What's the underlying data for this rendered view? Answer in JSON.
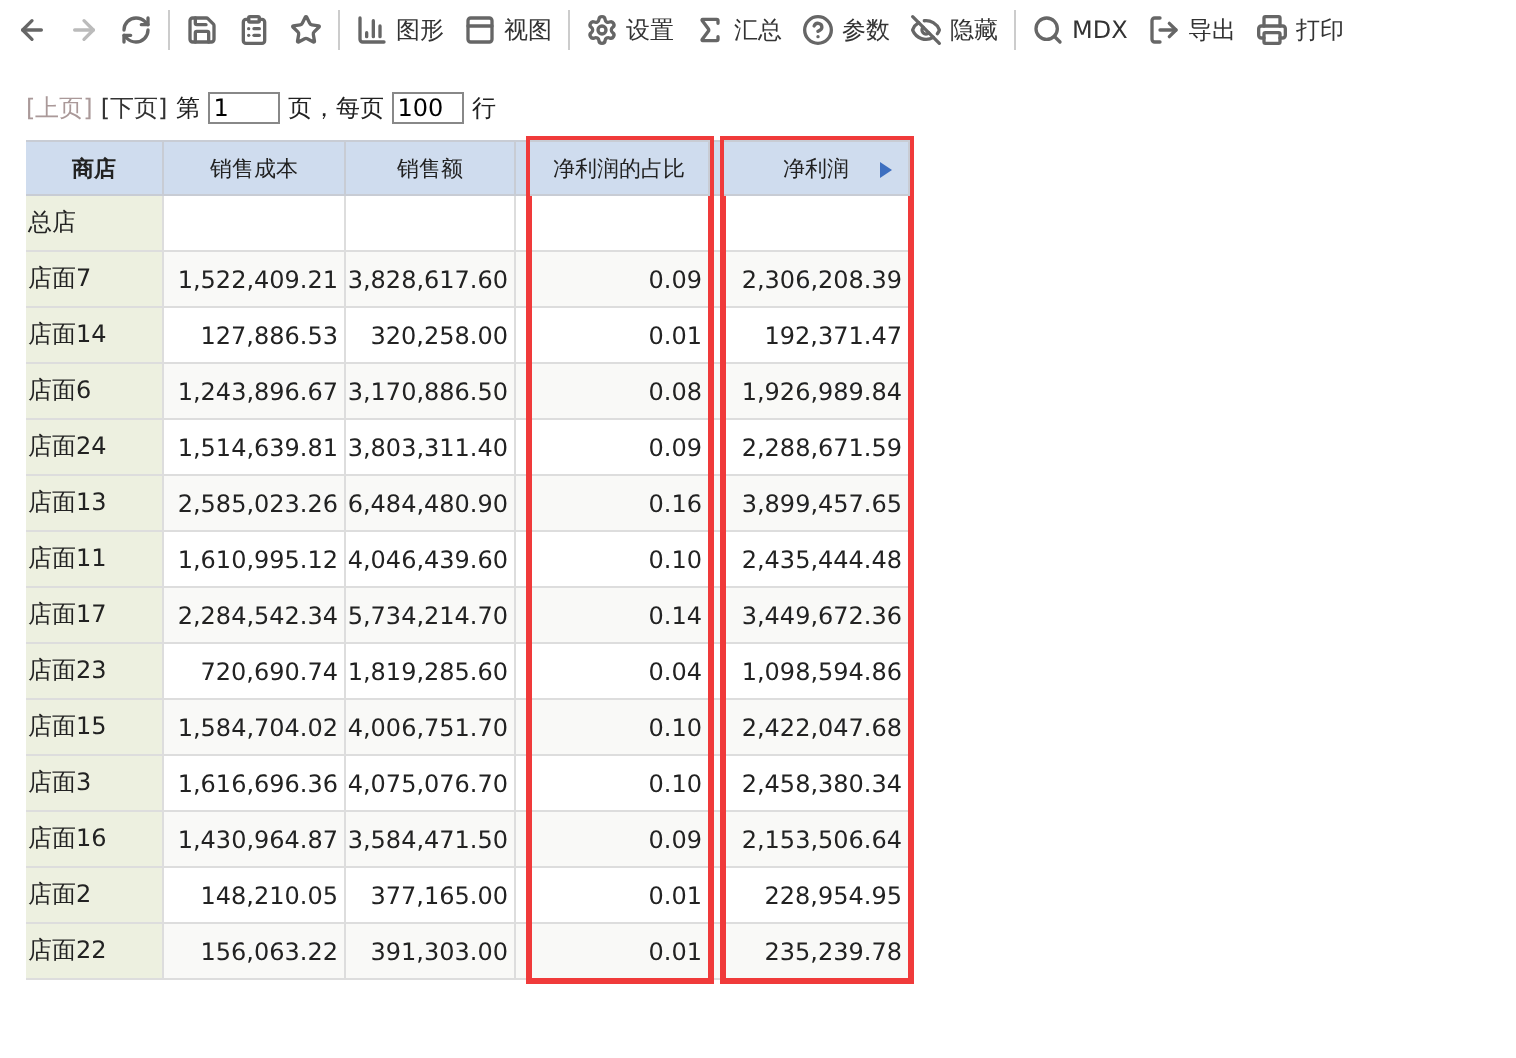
{
  "toolbar": [
    [
      {
        "disabled": false
      },
      {
        "disabled": true
      },
      {
        "disabled": false
      }
    ],
    [
      {
        "disabled": false
      },
      {
        "disabled": false
      },
      {
        "disabled": false
      }
    ],
    [
      {
        "label": "图形",
        "disabled": false
      },
      {
        "label": "视图",
        "disabled": false
      }
    ],
    [
      {
        "label": "设置",
        "disabled": false
      },
      {
        "label": "汇总",
        "disabled": false
      },
      {
        "label": "参数",
        "disabled": false
      },
      {
        "label": "隐藏",
        "disabled": false
      }
    ],
    [
      {
        "label": "MDX",
        "disabled": false
      },
      {
        "label": "导出",
        "disabled": false
      },
      {
        "label": "打印",
        "disabled": false
      }
    ]
  ],
  "pager": {
    "prev": {
      "label": "[上页]",
      "disabled": true
    },
    "next": {
      "label": "[下页]",
      "disabled": false
    },
    "page_prefix": "第",
    "page": "1",
    "per_page_prefix": "页，每页",
    "per_page": "100",
    "per_page_suffix": "行"
  },
  "table": {
    "columns": [
      {
        "label": "商店",
        "highlighted": false,
        "kind": "row_header"
      },
      {
        "label": "销售成本",
        "highlighted": false,
        "kind": "measure"
      },
      {
        "label": "销售额",
        "highlighted": false,
        "kind": "measure"
      },
      {
        "kind": "blank",
        "highlighted": false
      },
      {
        "label": "净利润的占比",
        "highlighted": true,
        "kind": "measure"
      },
      {
        "kind": "blank",
        "highlighted": false
      },
      {
        "label": "净利润",
        "highlighted": true,
        "kind": "measure",
        "expand_arrow": true
      }
    ],
    "rows": [
      {
        "store": "总店"
      },
      {
        "store": "店面7",
        "values": [
          "1,522,409.21",
          "3,828,617.60",
          "0.09",
          "2,306,208.39"
        ]
      },
      {
        "store": "店面14",
        "values": [
          "127,886.53",
          "320,258.00",
          "0.01",
          "192,371.47"
        ]
      },
      {
        "store": "店面6",
        "values": [
          "1,243,896.67",
          "3,170,886.50",
          "0.08",
          "1,926,989.84"
        ]
      },
      {
        "store": "店面24",
        "values": [
          "1,514,639.81",
          "3,803,311.40",
          "0.09",
          "2,288,671.59"
        ]
      },
      {
        "store": "店面13",
        "values": [
          "2,585,023.26",
          "6,484,480.90",
          "0.16",
          "3,899,457.65"
        ]
      },
      {
        "store": "店面11",
        "values": [
          "1,610,995.12",
          "4,046,439.60",
          "0.10",
          "2,435,444.48"
        ]
      },
      {
        "store": "店面17",
        "values": [
          "2,284,542.34",
          "5,734,214.70",
          "0.14",
          "3,449,672.36"
        ]
      },
      {
        "store": "店面23",
        "values": [
          "720,690.74",
          "1,819,285.60",
          "0.04",
          "1,098,594.86"
        ]
      },
      {
        "store": "店面15",
        "values": [
          "1,584,704.02",
          "4,006,751.70",
          "0.10",
          "2,422,047.68"
        ]
      },
      {
        "store": "店面3",
        "values": [
          "1,616,696.36",
          "4,075,076.70",
          "0.10",
          "2,458,380.34"
        ]
      },
      {
        "store": "店面16",
        "values": [
          "1,430,964.87",
          "3,584,471.50",
          "0.09",
          "2,153,506.64"
        ]
      },
      {
        "store": "店面2",
        "values": [
          "148,210.05",
          "377,165.00",
          "0.01",
          "228,954.95"
        ]
      },
      {
        "store": "店面22",
        "values": [
          "156,063.22",
          "391,303.00",
          "0.01",
          "235,239.78"
        ]
      }
    ]
  }
}
